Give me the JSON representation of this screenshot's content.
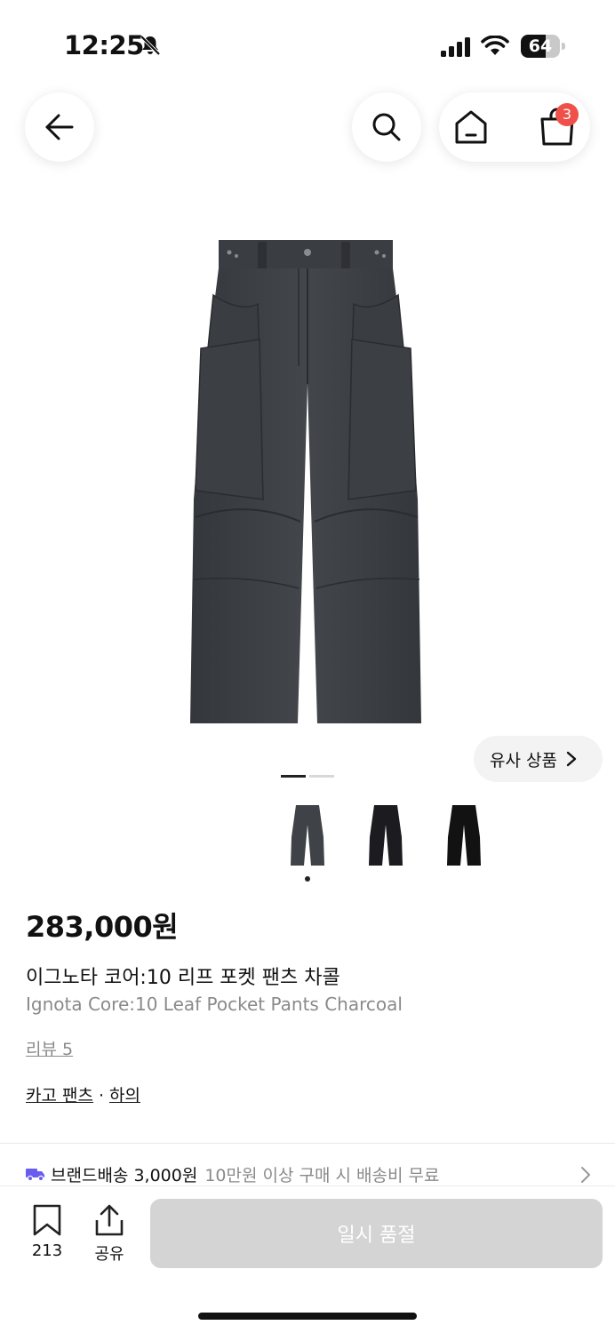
{
  "status_bar": {
    "time": "12:25",
    "battery": "64",
    "battery_level": 0.64
  },
  "nav": {
    "back_icon": "arrow-left-icon",
    "search_icon": "search-icon",
    "home_icon": "home-icon",
    "cart_icon": "shopping-bag-icon",
    "cart_count": "3"
  },
  "gallery": {
    "similar_label": "유사 상품",
    "page_count": 2,
    "active_page": 1,
    "thumbnail_colors": [
      "#3f4246",
      "#1c1c20",
      "#121212"
    ],
    "selected_thumbnail": 1
  },
  "product": {
    "price": "283,000원",
    "name_ko": "이그노타 코어:10 리프 포켓 팬츠 차콜",
    "name_en": "Ignota Core:10 Leaf Pocket Pants Charcoal",
    "reviews": "리뷰 5",
    "category_1": "카고 팬츠",
    "category_sep": "·",
    "category_2": "하의"
  },
  "shipping": {
    "main": "브랜드배송 3,000원",
    "sub": "10만원 이상 구매 시 배송비 무료",
    "icon": "truck-icon"
  },
  "bottom": {
    "save_count": "213",
    "share_label": "공유",
    "button_label": "일시 품절"
  },
  "colors": {
    "accent_badge": "#f0504a",
    "shipping_icon": "#6b5cf0",
    "disabled_button": "#d4d4d4"
  }
}
